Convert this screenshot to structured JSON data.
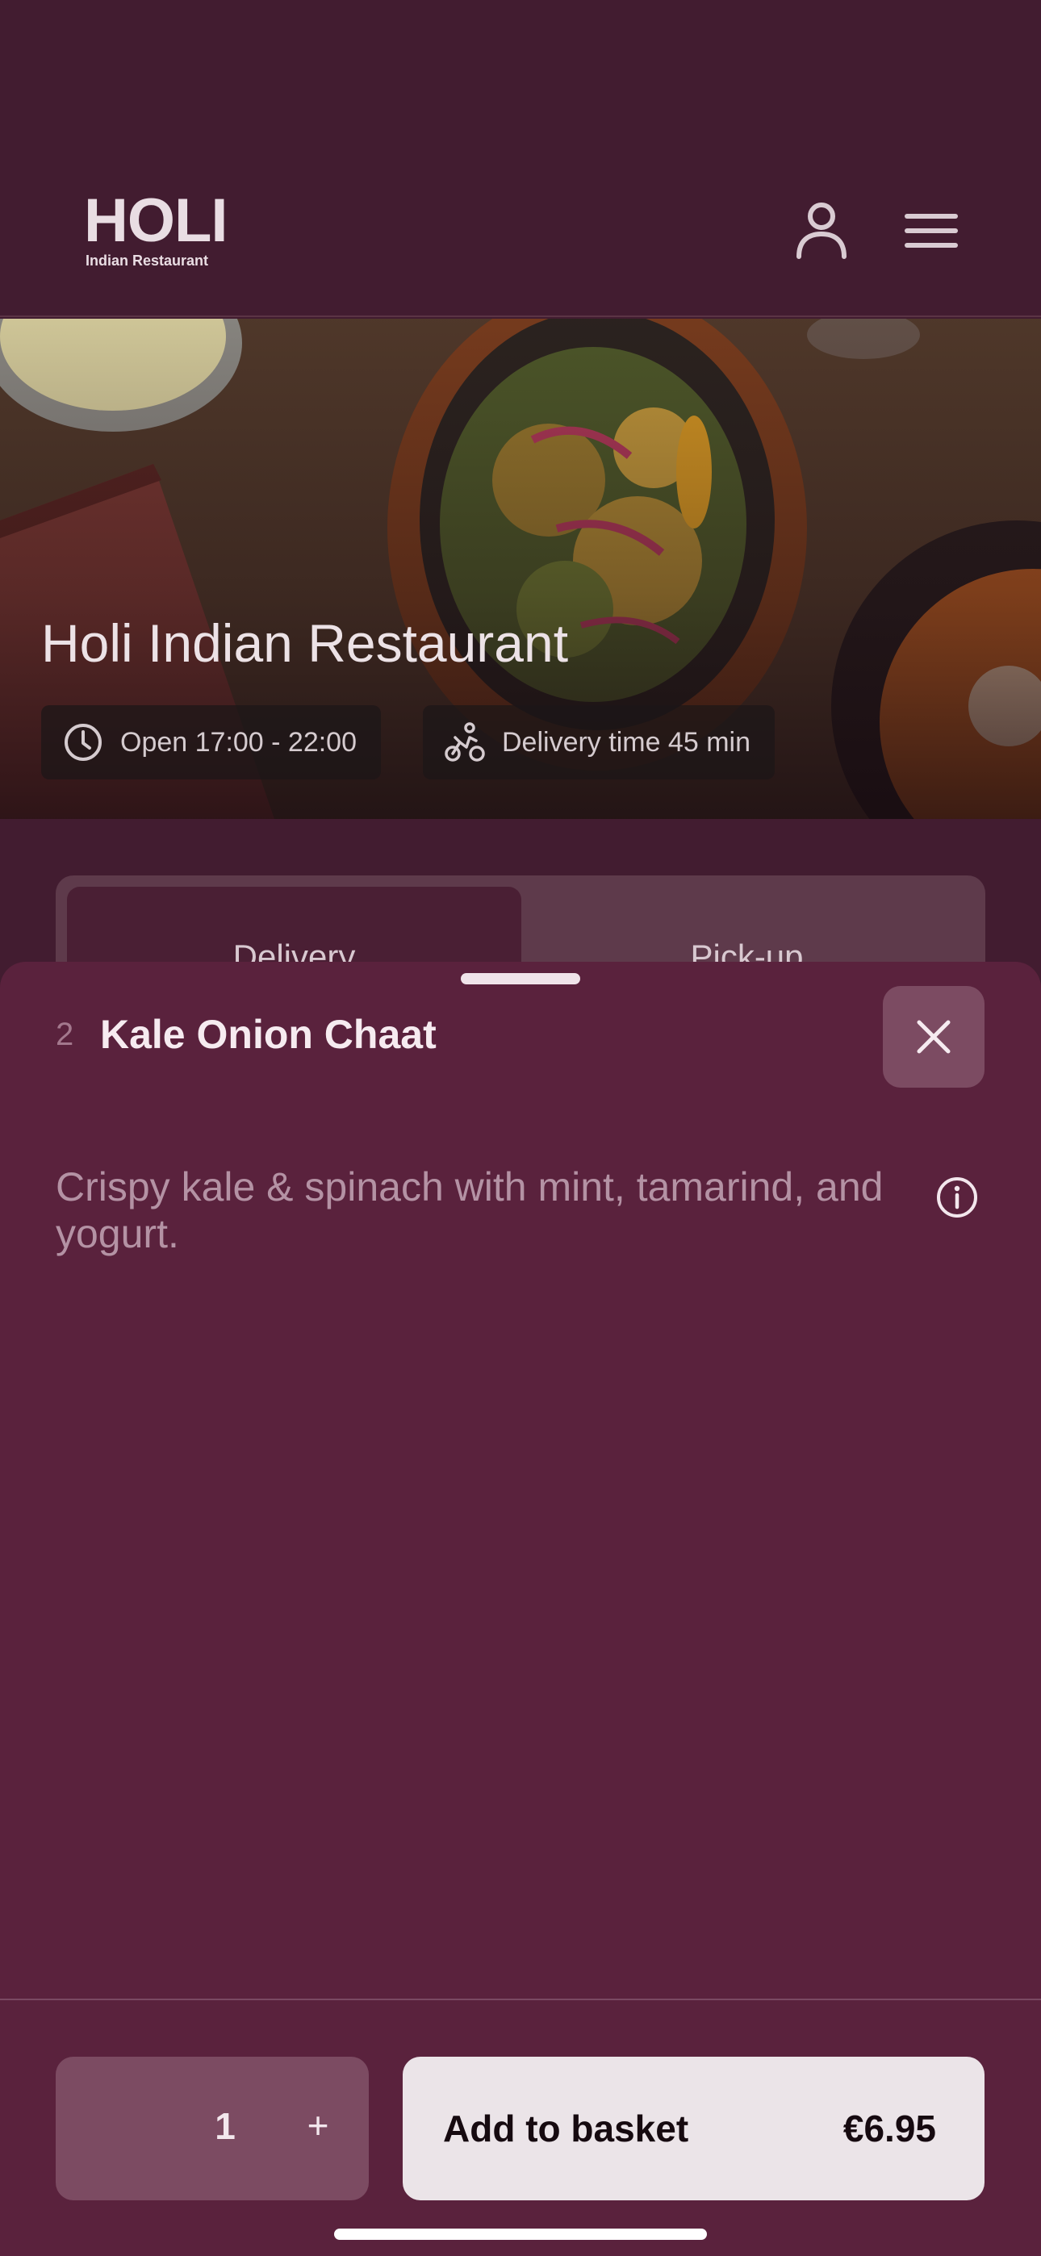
{
  "header": {
    "logo_word": "HOLI",
    "logo_subtitle": "Indian Restaurant",
    "account_icon": "user-icon",
    "menu_icon": "hamburger-menu-icon"
  },
  "hero": {
    "title": "Holi Indian Restaurant",
    "hours": "Open 17:00 - 22:00",
    "hours_icon": "clock-icon",
    "delivery": "Delivery time 45 min",
    "delivery_icon": "cyclist-icon"
  },
  "mode_toggle": {
    "options": [
      "Delivery",
      "Pick-up"
    ],
    "selected": "Delivery"
  },
  "item_sheet": {
    "number": "2",
    "name": "Kale Onion Chaat",
    "description": "Crispy kale & spinach with mint, tamarind, and yogurt.",
    "close_icon": "close-icon",
    "info_icon": "info-icon",
    "quantity": "1",
    "plus_label": "+",
    "add_label": "Add to basket",
    "price": "€6.95"
  },
  "colors": {
    "header_bg": "#421c30",
    "sheet_bg": "#5a223d",
    "secondary_button": "#7c4b62",
    "primary_button": "#ebe4e8"
  }
}
